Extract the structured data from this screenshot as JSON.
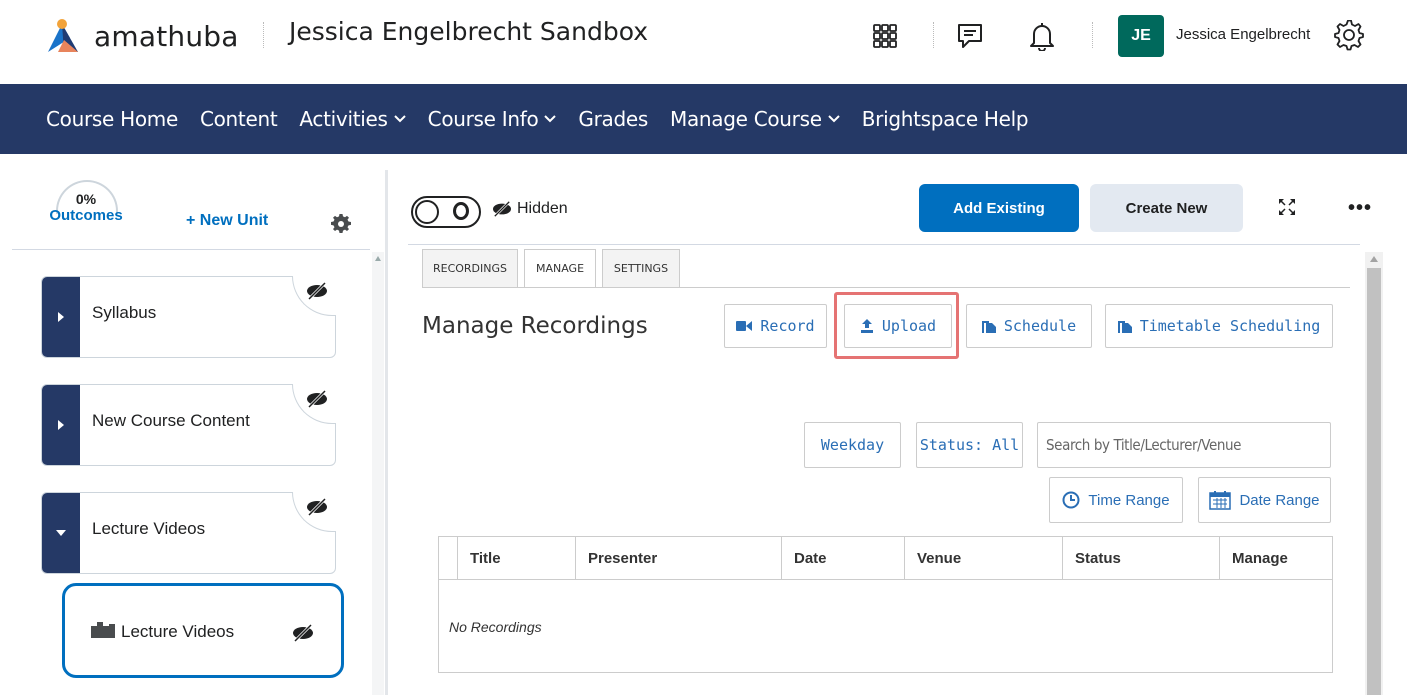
{
  "header": {
    "brand": "amathuba",
    "course_title": "Jessica Engelbrecht Sandbox",
    "user_initials": "JE",
    "user_name": "Jessica Engelbrecht",
    "avatar_color": "#00695c"
  },
  "nav": {
    "items": [
      {
        "label": "Course Home",
        "dropdown": false
      },
      {
        "label": "Content",
        "dropdown": false
      },
      {
        "label": "Activities",
        "dropdown": true
      },
      {
        "label": "Course Info",
        "dropdown": true
      },
      {
        "label": "Grades",
        "dropdown": false
      },
      {
        "label": "Manage Course",
        "dropdown": true
      },
      {
        "label": "Brightspace Help",
        "dropdown": false
      }
    ],
    "background": "#253966"
  },
  "sidebar": {
    "outcomes_percent": "0%",
    "outcomes_label": "Outcomes",
    "new_unit_label": "+ New Unit",
    "units": [
      {
        "label": "Syllabus",
        "expanded": false,
        "hidden": true
      },
      {
        "label": "New Course Content",
        "expanded": false,
        "hidden": true
      },
      {
        "label": "Lecture Videos",
        "expanded": true,
        "hidden": true
      }
    ],
    "lesson": {
      "label": "Lecture Videos",
      "hidden": true
    }
  },
  "toolbar": {
    "visibility_label": "Hidden",
    "add_existing_label": "Add Existing",
    "create_new_label": "Create New",
    "primary_color": "#006fbf"
  },
  "tool": {
    "tabs": [
      "RECORDINGS",
      "MANAGE",
      "SETTINGS"
    ],
    "active_tab": "MANAGE",
    "title": "Manage Recordings",
    "actions": {
      "record": "Record",
      "upload": "Upload",
      "schedule": "Schedule",
      "timetable": "Timetable Scheduling"
    },
    "filters": {
      "weekday": "Weekday",
      "status": "Status: All",
      "search_placeholder": "Search by Title/Lecturer/Venue",
      "time_range": "Time Range",
      "date_range": "Date Range"
    },
    "table": {
      "columns": [
        "Title",
        "Presenter",
        "Date",
        "Venue",
        "Status",
        "Manage"
      ],
      "empty_text": "No Recordings"
    },
    "highlight_color": "#e57373"
  }
}
